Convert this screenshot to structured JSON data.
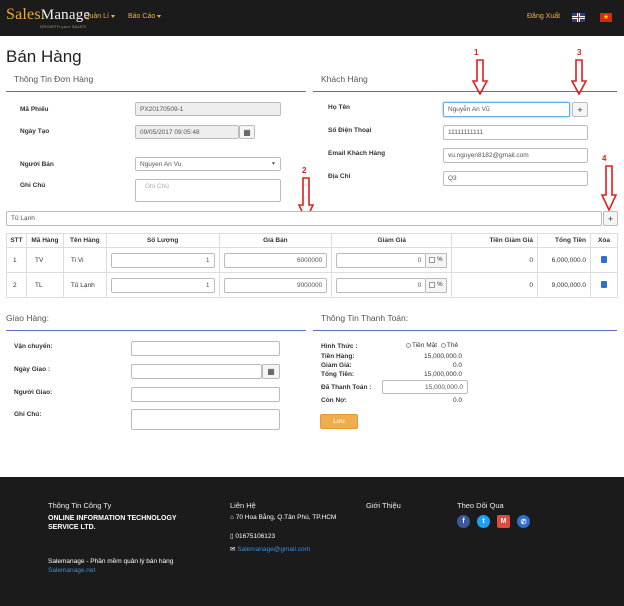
{
  "navbar": {
    "logo_prefix": "Sales",
    "logo_suffix": "Manage",
    "logo_tagline": "GROWTH your SALES",
    "menu_manage": "Quản Lí",
    "menu_report": "Báo Cáo",
    "logout": "Đăng Xuất"
  },
  "page": {
    "title": "Bán Hàng"
  },
  "order_info": {
    "title": "Thông Tin Đơn Hàng",
    "code_label": "Mã Phiếu",
    "code_value": "PX20170509-1",
    "date_label": "Ngày Tạo",
    "date_value": "09/05/2017 09:05:48",
    "seller_label": "Người Bán",
    "seller_value": "Nguyen An Vu",
    "note_label": "Ghi Chú",
    "note_placeholder": "Ghi Chú"
  },
  "customer": {
    "title": "Khách Hàng",
    "name_label": "Họ Tên",
    "name_value": "Nguyễn An Vũ",
    "phone_label": "Số Điện Thoại",
    "phone_value": "11111111111",
    "email_label": "Email Khách Hàng",
    "email_value": "vu.nguyen8182@gmail.com",
    "address_label": "Địa Chỉ",
    "address_value": "Q3"
  },
  "annotations": {
    "n1": "1",
    "n2": "2",
    "n3": "3",
    "n4": "4"
  },
  "product_search": {
    "value": "Tủ Lạnh"
  },
  "items_table": {
    "headers": [
      "STT",
      "Mã Hàng",
      "Tên Hàng",
      "Số Lượng",
      "Giá Bán",
      "Giảm Giá",
      "Tiền Giảm Giá",
      "Tổng Tiền",
      "Xóa"
    ],
    "percent_label": "%",
    "rows": [
      {
        "stt": "1",
        "code": "TV",
        "name": "Ti Vi",
        "qty": "1",
        "price": "6000000",
        "discount": "0",
        "discount_amount": "0",
        "total": "6,000,000.0"
      },
      {
        "stt": "2",
        "code": "TL",
        "name": "Tủ Lạnh",
        "qty": "1",
        "price": "9000000",
        "discount": "0",
        "discount_amount": "0",
        "total": "9,000,000.0"
      }
    ]
  },
  "delivery": {
    "title": "Giao Hàng:",
    "shipping_label": "Vận chuyển:",
    "date_label": "Ngày Giao :",
    "person_label": "Người Giao:",
    "note_label": "Ghi Chú:"
  },
  "payment": {
    "title": "Thông Tin Thanh Toán:",
    "method_label": "Hình Thức :",
    "cash_label": "Tiền Mặt",
    "card_label": "Thẻ",
    "subtotal_label": "Tiền Hàng:",
    "subtotal_value": "15,000,000.0",
    "discount_label": "Giảm Giá:",
    "discount_value": "0.0",
    "total_label": "Tổng Tiền:",
    "total_value": "15,000,000.0",
    "paid_label": "Đã Thanh Toán :",
    "paid_value": "15,000,000.0",
    "debt_label": "Còn Nợ:",
    "debt_value": "0.0",
    "save_label": "Lưu"
  },
  "footer": {
    "company_title": "Thông Tin Công Ty",
    "company_name": "ONLINE INFORMATION TECHNOLOGY SERVICE LTD.",
    "slogan": "Salemanage - Phần mềm quản lý bán hàng",
    "site": "Salemanage.net",
    "contact_title": "Liên Hệ",
    "address": "70 Hoa Bằng, Q.Tân Phú, TP.HCM",
    "phone": "01675106123",
    "email": "Salemanage@gmail.com",
    "intro_title": "Giới Thiệu",
    "follow_title": "Theo Dõi Qua"
  },
  "colors": {
    "accent": "#f0b040",
    "rule": "#5b6fc8",
    "arrow": "#e02020",
    "save": "#f0ad4e",
    "link": "#3a8fe0"
  }
}
